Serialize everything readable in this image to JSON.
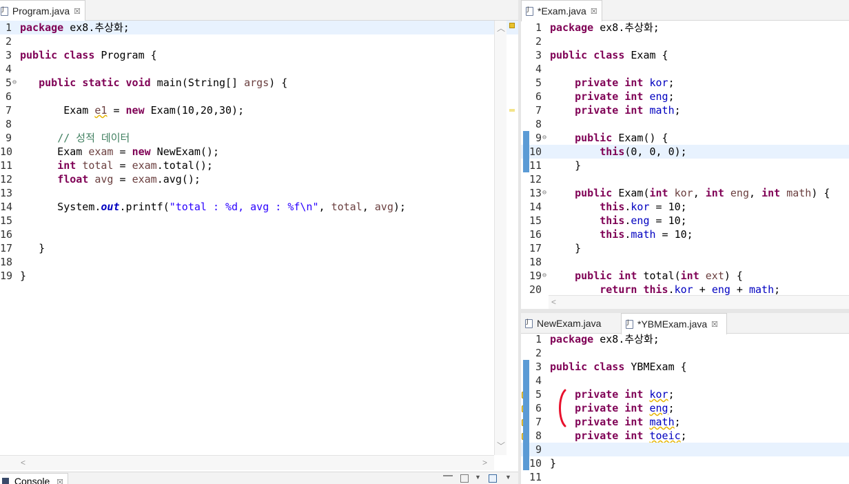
{
  "left_editor": {
    "tab": {
      "label": "Program.java",
      "close": "☒"
    },
    "lines": [
      {
        "n": "1",
        "tokens": [
          {
            "t": "package",
            "c": "kw"
          },
          {
            "t": " ex8.추상화;",
            "c": ""
          }
        ],
        "hl": true
      },
      {
        "n": "2",
        "tokens": []
      },
      {
        "n": "3",
        "tokens": [
          {
            "t": "public",
            "c": "kw"
          },
          {
            "t": " ",
            "c": ""
          },
          {
            "t": "class",
            "c": "kw"
          },
          {
            "t": " Program {",
            "c": ""
          }
        ]
      },
      {
        "n": "4",
        "tokens": []
      },
      {
        "n": "5",
        "fold": "⊖",
        "tokens": [
          {
            "t": "   ",
            "c": ""
          },
          {
            "t": "public",
            "c": "kw"
          },
          {
            "t": " ",
            "c": ""
          },
          {
            "t": "static",
            "c": "kw"
          },
          {
            "t": " ",
            "c": ""
          },
          {
            "t": "void",
            "c": "kw"
          },
          {
            "t": " main(String[] ",
            "c": ""
          },
          {
            "t": "args",
            "c": "loc"
          },
          {
            "t": ") {",
            "c": ""
          }
        ]
      },
      {
        "n": "6",
        "tokens": []
      },
      {
        "n": "7",
        "tokens": [
          {
            "t": "       Exam ",
            "c": ""
          },
          {
            "t": "e1",
            "c": "loc warnul"
          },
          {
            "t": " = ",
            "c": ""
          },
          {
            "t": "new",
            "c": "kw"
          },
          {
            "t": " Exam(10,20,30);",
            "c": ""
          }
        ]
      },
      {
        "n": "8",
        "tokens": []
      },
      {
        "n": "9",
        "tokens": [
          {
            "t": "      ",
            "c": ""
          },
          {
            "t": "// 성적 데이터",
            "c": "cmt"
          }
        ]
      },
      {
        "n": "10",
        "tokens": [
          {
            "t": "      Exam ",
            "c": ""
          },
          {
            "t": "exam",
            "c": "loc"
          },
          {
            "t": " = ",
            "c": ""
          },
          {
            "t": "new",
            "c": "kw"
          },
          {
            "t": " NewExam();",
            "c": ""
          }
        ]
      },
      {
        "n": "11",
        "tokens": [
          {
            "t": "      ",
            "c": ""
          },
          {
            "t": "int",
            "c": "kw"
          },
          {
            "t": " ",
            "c": ""
          },
          {
            "t": "total",
            "c": "loc"
          },
          {
            "t": " = ",
            "c": ""
          },
          {
            "t": "exam",
            "c": "loc"
          },
          {
            "t": ".total();",
            "c": ""
          }
        ]
      },
      {
        "n": "12",
        "tokens": [
          {
            "t": "      ",
            "c": ""
          },
          {
            "t": "float",
            "c": "kw"
          },
          {
            "t": " ",
            "c": ""
          },
          {
            "t": "avg",
            "c": "loc"
          },
          {
            "t": " = ",
            "c": ""
          },
          {
            "t": "exam",
            "c": "loc"
          },
          {
            "t": ".avg();",
            "c": ""
          }
        ]
      },
      {
        "n": "13",
        "tokens": []
      },
      {
        "n": "14",
        "tokens": [
          {
            "t": "      System.",
            "c": ""
          },
          {
            "t": "out",
            "c": "sfield"
          },
          {
            "t": ".printf(",
            "c": ""
          },
          {
            "t": "\"total : %d, avg : %f\\n\"",
            "c": "str"
          },
          {
            "t": ", ",
            "c": ""
          },
          {
            "t": "total",
            "c": "loc"
          },
          {
            "t": ", ",
            "c": ""
          },
          {
            "t": "avg",
            "c": "loc"
          },
          {
            "t": ");",
            "c": ""
          }
        ]
      },
      {
        "n": "15",
        "tokens": []
      },
      {
        "n": "16",
        "tokens": []
      },
      {
        "n": "17",
        "tokens": [
          {
            "t": "   }",
            "c": ""
          }
        ]
      },
      {
        "n": "18",
        "tokens": []
      },
      {
        "n": "19",
        "tokens": [
          {
            "t": "}",
            "c": ""
          }
        ]
      }
    ]
  },
  "console": {
    "label": "Console",
    "close": "☒"
  },
  "right_top_editor": {
    "tab": {
      "label": "*Exam.java",
      "close": "☒"
    },
    "lines": [
      {
        "n": "1",
        "tokens": [
          {
            "t": "package",
            "c": "kw"
          },
          {
            "t": " ex8.추상화;",
            "c": ""
          }
        ]
      },
      {
        "n": "2",
        "tokens": []
      },
      {
        "n": "3",
        "tokens": [
          {
            "t": "public",
            "c": "kw"
          },
          {
            "t": " ",
            "c": ""
          },
          {
            "t": "class",
            "c": "kw"
          },
          {
            "t": " Exam {",
            "c": ""
          }
        ]
      },
      {
        "n": "4",
        "tokens": []
      },
      {
        "n": "5",
        "tokens": [
          {
            "t": "    ",
            "c": ""
          },
          {
            "t": "private",
            "c": "kw"
          },
          {
            "t": " ",
            "c": ""
          },
          {
            "t": "int",
            "c": "kw"
          },
          {
            "t": " ",
            "c": ""
          },
          {
            "t": "kor",
            "c": "fld"
          },
          {
            "t": ";",
            "c": ""
          }
        ]
      },
      {
        "n": "6",
        "tokens": [
          {
            "t": "    ",
            "c": ""
          },
          {
            "t": "private",
            "c": "kw"
          },
          {
            "t": " ",
            "c": ""
          },
          {
            "t": "int",
            "c": "kw"
          },
          {
            "t": " ",
            "c": ""
          },
          {
            "t": "eng",
            "c": "fld"
          },
          {
            "t": ";",
            "c": ""
          }
        ]
      },
      {
        "n": "7",
        "tokens": [
          {
            "t": "    ",
            "c": ""
          },
          {
            "t": "private",
            "c": "kw"
          },
          {
            "t": " ",
            "c": ""
          },
          {
            "t": "int",
            "c": "kw"
          },
          {
            "t": " ",
            "c": ""
          },
          {
            "t": "math",
            "c": "fld"
          },
          {
            "t": ";",
            "c": ""
          }
        ]
      },
      {
        "n": "8",
        "tokens": []
      },
      {
        "n": "9",
        "fold": "⊖",
        "tokens": [
          {
            "t": "    ",
            "c": ""
          },
          {
            "t": "public",
            "c": "kw"
          },
          {
            "t": " Exam() {",
            "c": ""
          }
        ]
      },
      {
        "n": "10",
        "hl": true,
        "tokens": [
          {
            "t": "        ",
            "c": ""
          },
          {
            "t": "this",
            "c": "kw"
          },
          {
            "t": "(0, 0, 0);",
            "c": ""
          }
        ]
      },
      {
        "n": "11",
        "tokens": [
          {
            "t": "    }",
            "c": ""
          }
        ]
      },
      {
        "n": "12",
        "tokens": []
      },
      {
        "n": "13",
        "fold": "⊖",
        "tokens": [
          {
            "t": "    ",
            "c": ""
          },
          {
            "t": "public",
            "c": "kw"
          },
          {
            "t": " Exam(",
            "c": ""
          },
          {
            "t": "int",
            "c": "kw"
          },
          {
            "t": " ",
            "c": ""
          },
          {
            "t": "kor",
            "c": "loc"
          },
          {
            "t": ", ",
            "c": ""
          },
          {
            "t": "int",
            "c": "kw"
          },
          {
            "t": " ",
            "c": ""
          },
          {
            "t": "eng",
            "c": "loc"
          },
          {
            "t": ", ",
            "c": ""
          },
          {
            "t": "int",
            "c": "kw"
          },
          {
            "t": " ",
            "c": ""
          },
          {
            "t": "math",
            "c": "loc"
          },
          {
            "t": ") {",
            "c": ""
          }
        ]
      },
      {
        "n": "14",
        "tokens": [
          {
            "t": "        ",
            "c": ""
          },
          {
            "t": "this",
            "c": "kw"
          },
          {
            "t": ".",
            "c": ""
          },
          {
            "t": "kor",
            "c": "fld"
          },
          {
            "t": " = 10;",
            "c": ""
          }
        ]
      },
      {
        "n": "15",
        "tokens": [
          {
            "t": "        ",
            "c": ""
          },
          {
            "t": "this",
            "c": "kw"
          },
          {
            "t": ".",
            "c": ""
          },
          {
            "t": "eng",
            "c": "fld"
          },
          {
            "t": " = 10;",
            "c": ""
          }
        ]
      },
      {
        "n": "16",
        "tokens": [
          {
            "t": "        ",
            "c": ""
          },
          {
            "t": "this",
            "c": "kw"
          },
          {
            "t": ".",
            "c": ""
          },
          {
            "t": "math",
            "c": "fld"
          },
          {
            "t": " = 10;",
            "c": ""
          }
        ]
      },
      {
        "n": "17",
        "tokens": [
          {
            "t": "    }",
            "c": ""
          }
        ]
      },
      {
        "n": "18",
        "tokens": []
      },
      {
        "n": "19",
        "fold": "⊖",
        "tokens": [
          {
            "t": "    ",
            "c": ""
          },
          {
            "t": "public",
            "c": "kw"
          },
          {
            "t": " ",
            "c": ""
          },
          {
            "t": "int",
            "c": "kw"
          },
          {
            "t": " total(",
            "c": ""
          },
          {
            "t": "int",
            "c": "kw"
          },
          {
            "t": " ",
            "c": ""
          },
          {
            "t": "ext",
            "c": "loc"
          },
          {
            "t": ") {",
            "c": ""
          }
        ]
      },
      {
        "n": "20",
        "tokens": [
          {
            "t": "        ",
            "c": ""
          },
          {
            "t": "return",
            "c": "kw"
          },
          {
            "t": " ",
            "c": ""
          },
          {
            "t": "this",
            "c": "kw"
          },
          {
            "t": ".",
            "c": ""
          },
          {
            "t": "kor",
            "c": "fld"
          },
          {
            "t": " + ",
            "c": ""
          },
          {
            "t": "eng",
            "c": "fld"
          },
          {
            "t": " + ",
            "c": ""
          },
          {
            "t": "math",
            "c": "fld"
          },
          {
            "t": ";",
            "c": ""
          }
        ]
      }
    ]
  },
  "right_bottom_editor": {
    "tabs": [
      {
        "label": "NewExam.java",
        "close": ""
      },
      {
        "label": "*YBMExam.java",
        "close": "☒"
      }
    ],
    "lines": [
      {
        "n": "1",
        "tokens": [
          {
            "t": "package",
            "c": "kw"
          },
          {
            "t": " ex8.추상화;",
            "c": ""
          }
        ]
      },
      {
        "n": "2",
        "tokens": []
      },
      {
        "n": "3",
        "tokens": [
          {
            "t": "public",
            "c": "kw"
          },
          {
            "t": " ",
            "c": ""
          },
          {
            "t": "class",
            "c": "kw"
          },
          {
            "t": " YBMExam {",
            "c": ""
          }
        ]
      },
      {
        "n": "4",
        "tokens": []
      },
      {
        "n": "5",
        "warn": "!",
        "tokens": [
          {
            "t": "    ",
            "c": ""
          },
          {
            "t": "private",
            "c": "kw"
          },
          {
            "t": " ",
            "c": ""
          },
          {
            "t": "int",
            "c": "kw"
          },
          {
            "t": " ",
            "c": ""
          },
          {
            "t": "kor",
            "c": "fld warnul"
          },
          {
            "t": ";",
            "c": ""
          }
        ]
      },
      {
        "n": "6",
        "warn": "!",
        "tokens": [
          {
            "t": "    ",
            "c": ""
          },
          {
            "t": "private",
            "c": "kw"
          },
          {
            "t": " ",
            "c": ""
          },
          {
            "t": "int",
            "c": "kw"
          },
          {
            "t": " ",
            "c": ""
          },
          {
            "t": "eng",
            "c": "fld warnul"
          },
          {
            "t": ";",
            "c": ""
          }
        ]
      },
      {
        "n": "7",
        "warn": "!",
        "tokens": [
          {
            "t": "    ",
            "c": ""
          },
          {
            "t": "private",
            "c": "kw"
          },
          {
            "t": " ",
            "c": ""
          },
          {
            "t": "int",
            "c": "kw"
          },
          {
            "t": " ",
            "c": ""
          },
          {
            "t": "math",
            "c": "fld warnul"
          },
          {
            "t": ";",
            "c": ""
          }
        ]
      },
      {
        "n": "8",
        "warn": "!",
        "tokens": [
          {
            "t": "    ",
            "c": ""
          },
          {
            "t": "private",
            "c": "kw"
          },
          {
            "t": " ",
            "c": ""
          },
          {
            "t": "int",
            "c": "kw"
          },
          {
            "t": " ",
            "c": ""
          },
          {
            "t": "toeic",
            "c": "fld warnul"
          },
          {
            "t": ";",
            "c": ""
          }
        ]
      },
      {
        "n": "9",
        "hl": true,
        "tokens": []
      },
      {
        "n": "10",
        "tokens": [
          {
            "t": "}",
            "c": ""
          }
        ]
      },
      {
        "n": "11",
        "tokens": []
      }
    ]
  },
  "colors": {
    "keyword": "#7f0055",
    "field": "#0000c0",
    "string": "#2a00ff",
    "comment": "#3f7f5f",
    "current_line": "#e8f2fe",
    "annotation_mark": "#e8112d"
  }
}
